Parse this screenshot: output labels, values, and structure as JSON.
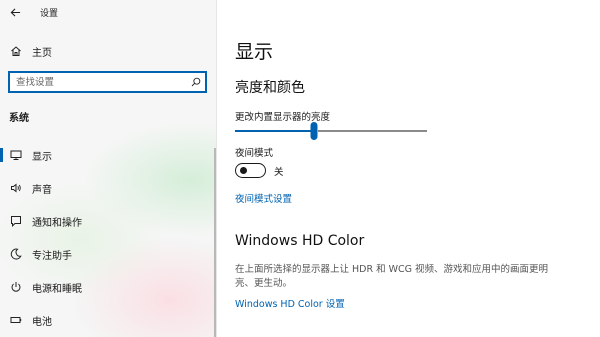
{
  "window": {
    "title": "设置"
  },
  "sidebar": {
    "home_label": "主页",
    "search_placeholder": "查找设置",
    "section_label": "系统",
    "items": [
      {
        "label": "显示",
        "icon": "monitor-icon",
        "selected": true
      },
      {
        "label": "声音",
        "icon": "speaker-icon",
        "selected": false
      },
      {
        "label": "通知和操作",
        "icon": "notification-icon",
        "selected": false
      },
      {
        "label": "专注助手",
        "icon": "moon-icon",
        "selected": false
      },
      {
        "label": "电源和睡眠",
        "icon": "power-icon",
        "selected": false
      },
      {
        "label": "电池",
        "icon": "battery-icon",
        "selected": false
      }
    ]
  },
  "main": {
    "page_title": "显示",
    "brightness_color_heading": "亮度和颜色",
    "brightness_label": "更改内置显示器的亮度",
    "brightness_value": 0.41,
    "night_mode_label": "夜间模式",
    "night_mode_state": "关",
    "night_mode_settings_link": "夜间模式设置",
    "hd_color_heading": "Windows HD Color",
    "hd_color_description": "在上面所选择的显示器上让 HDR 和 WCG 视频、游戏和应用中的画面更明亮、更生动。",
    "hd_color_settings_link": "Windows HD Color 设置"
  },
  "colors": {
    "accent": "#0063b1",
    "text": "#1a1a1a",
    "muted_text": "#555555"
  }
}
